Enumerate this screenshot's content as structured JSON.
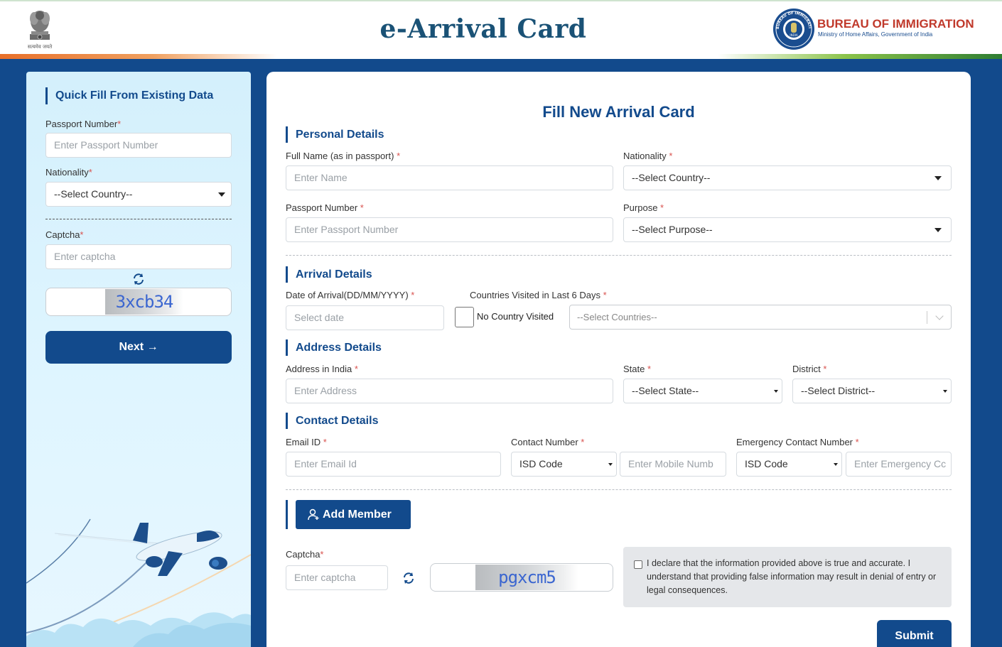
{
  "header": {
    "emblem_caption": "सत्यमेव जयते",
    "title": "e-Arrival Card",
    "agency_name": "BUREAU OF IMMIGRATION",
    "agency_sub": "Ministry of Home Affairs, Government of India",
    "agency_seal_text": "BUREAU OF IMMIGRATION · MINISTRY OF HOME AFFAIRS",
    "agency_seal_center": "INDIA"
  },
  "quick_fill": {
    "heading": "Quick Fill From Existing Data",
    "passport_label": "Passport Number",
    "passport_placeholder": "Enter Passport Number",
    "nationality_label": "Nationality",
    "nationality_value": "--Select Country--",
    "captcha_label": "Captcha",
    "captcha_placeholder": "Enter captcha",
    "captcha_text": "3xcb34",
    "next_label": "Next →"
  },
  "form": {
    "title": "Fill New Arrival Card",
    "personal": {
      "heading": "Personal Details",
      "fullname_label": "Full Name (as in passport)",
      "fullname_placeholder": "Enter Name",
      "nationality_label": "Nationality",
      "nationality_value": "--Select Country--",
      "passport_label": "Passport Number",
      "passport_placeholder": "Enter Passport Number",
      "purpose_label": "Purpose",
      "purpose_value": "--Select Purpose--"
    },
    "arrival": {
      "heading": "Arrival Details",
      "date_label": "Date of Arrival(DD/MM/YYYY)",
      "date_placeholder": "Select date",
      "countries_label": "Countries Visited in Last 6 Days",
      "no_country_label": "No Country Visited",
      "countries_value": "--Select Countries--"
    },
    "address": {
      "heading": "Address Details",
      "address_label": "Address in India",
      "address_placeholder": "Enter Address",
      "state_label": "State",
      "state_value": "--Select State--",
      "district_label": "District",
      "district_value": "--Select District--"
    },
    "contact": {
      "heading": "Contact Details",
      "email_label": "Email ID",
      "email_placeholder": "Enter Email Id",
      "contact_label": "Contact Number",
      "isd_value": "ISD Code",
      "mobile_placeholder": "Enter Mobile Numb",
      "emergency_label": "Emergency Contact Number",
      "emergency_isd_value": "ISD Code",
      "emergency_placeholder": "Enter Emergency Cc"
    },
    "add_member_label": "Add Member",
    "captcha_label": "Captcha",
    "captcha_placeholder": "Enter captcha",
    "captcha_text": "pgxcm5",
    "declaration": "I declare that the information provided above is true and accurate. I understand that providing false information may result in denial of entry or legal consequences.",
    "submit_label": "Submit"
  },
  "required_mark": "*",
  "colors": {
    "primary": "#124a8c",
    "agency_red": "#c0392b",
    "required": "#d9534f",
    "panel_bg": "#d4f0fc"
  }
}
